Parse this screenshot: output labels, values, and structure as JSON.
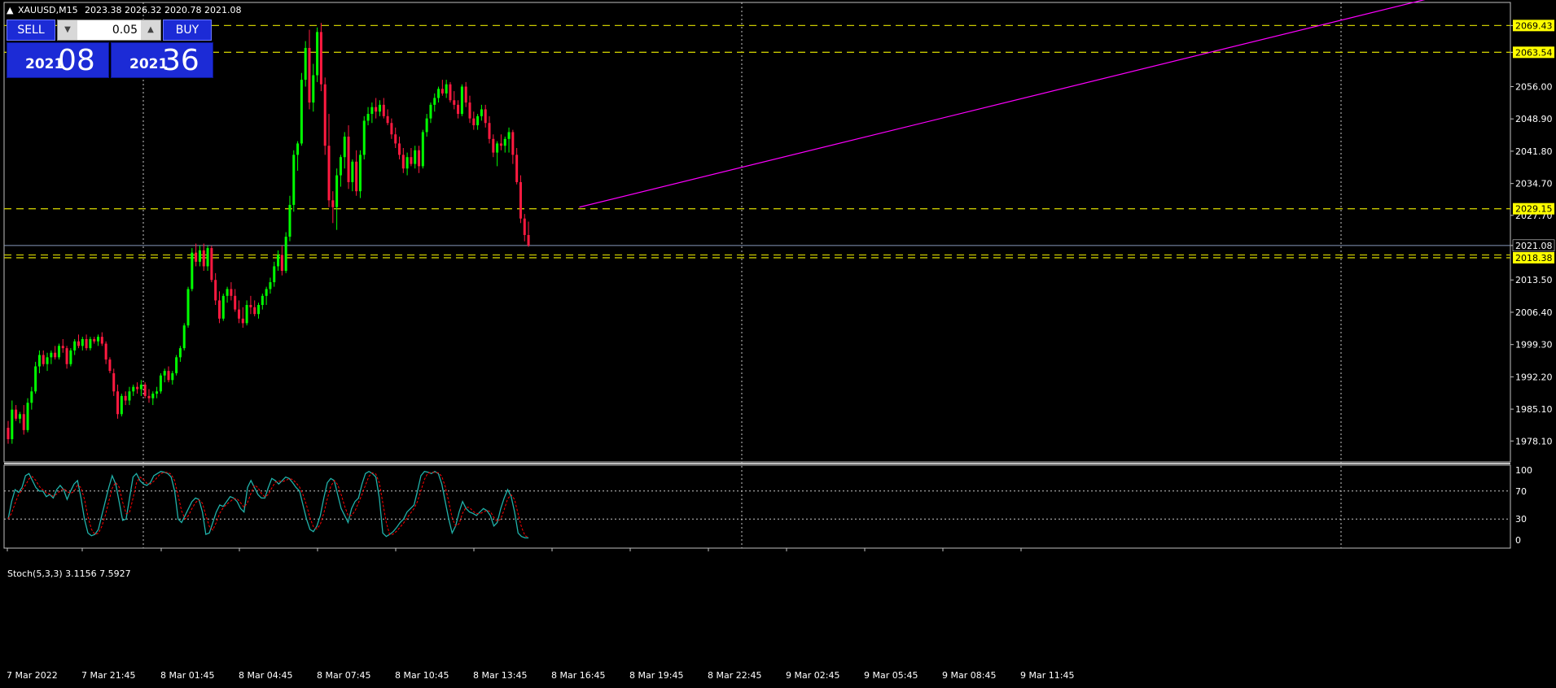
{
  "header": {
    "symbol_label": "XAUUSD,M15",
    "ohlc_label": "2023.38 2026.32 2020.78 2021.08"
  },
  "trade_panel": {
    "sell_label": "SELL",
    "buy_label": "BUY",
    "lot_value": "0.05",
    "down_glyph": "▼",
    "up_glyph": "▲",
    "sell_price_small": "2021",
    "sell_price_big": "08",
    "buy_price_small": "2021",
    "buy_price_big": "36"
  },
  "indicator": {
    "label": "Stoch(5,3,3) 3.1156 7.5927",
    "levels": [
      {
        "text": "100",
        "value": 100
      },
      {
        "text": "70",
        "value": 70
      },
      {
        "text": "30",
        "value": 30
      },
      {
        "text": "0",
        "value": 0
      }
    ],
    "main_color": "#20b2aa",
    "signal_color": "#ff0000",
    "main": [
      30,
      55,
      72,
      68,
      75,
      92,
      95,
      85,
      75,
      70,
      70,
      62,
      65,
      60,
      72,
      78,
      72,
      58,
      70,
      80,
      85,
      60,
      30,
      10,
      6,
      8,
      15,
      35,
      55,
      75,
      92,
      80,
      55,
      28,
      30,
      60,
      90,
      95,
      85,
      80,
      78,
      82,
      92,
      95,
      98,
      97,
      95,
      90,
      70,
      30,
      25,
      35,
      45,
      55,
      60,
      58,
      40,
      8,
      10,
      25,
      40,
      50,
      48,
      55,
      62,
      60,
      55,
      45,
      40,
      75,
      85,
      75,
      65,
      60,
      60,
      75,
      88,
      85,
      80,
      85,
      90,
      88,
      82,
      75,
      70,
      50,
      30,
      15,
      12,
      20,
      35,
      60,
      82,
      88,
      85,
      65,
      45,
      35,
      25,
      45,
      55,
      60,
      80,
      95,
      98,
      95,
      90,
      60,
      10,
      5,
      8,
      12,
      18,
      25,
      30,
      40,
      45,
      50,
      70,
      92,
      98,
      97,
      95,
      98,
      95,
      80,
      55,
      30,
      10,
      20,
      40,
      55,
      45,
      40,
      38,
      35,
      40,
      45,
      42,
      35,
      20,
      25,
      45,
      60,
      72,
      62,
      40,
      10,
      5,
      3,
      3
    ]
  },
  "time_axis": {
    "labels": [
      "7 Mar 2022",
      "7 Mar 21:45",
      "8 Mar 01:45",
      "8 Mar 04:45",
      "8 Mar 07:45",
      "8 Mar 10:45",
      "8 Mar 13:45",
      "8 Mar 16:45",
      "8 Mar 19:45",
      "8 Mar 22:45",
      "9 Mar 02:45",
      "9 Mar 05:45",
      "9 Mar 08:45",
      "9 Mar 11:45"
    ]
  },
  "chart_data": {
    "type": "candlestick",
    "symbol": "XAUUSD",
    "timeframe": "M15",
    "y_range": [
      1973.5,
      2074.5
    ],
    "y_ticks": [
      2069.43,
      2063.54,
      2056.0,
      2048.9,
      2041.8,
      2034.7,
      2027.7,
      2021.08,
      2013.5,
      2006.4,
      1999.3,
      1992.2,
      1985.1,
      1978.1
    ],
    "y_tick_labels": [
      "2069.43",
      "2063.54",
      "2056.00",
      "2048.90",
      "2041.80",
      "2034.70",
      "2027.70",
      "2021.08",
      "2013.50",
      "2006.40",
      "1999.30",
      "1992.20",
      "1985.10",
      "1978.10"
    ],
    "bull_color": "#00ff00",
    "bear_color": "#ff1a40",
    "horizontal_levels": [
      {
        "price": 2069.43,
        "label": "2069.43",
        "color": "#c8c800"
      },
      {
        "price": 2063.54,
        "label": "2063.54",
        "color": "#c8c800"
      },
      {
        "price": 2029.15,
        "label": "2029.15",
        "color": "#c8c800"
      },
      {
        "price": 2019.0,
        "label": "",
        "color": "#c8c800"
      },
      {
        "price": 2018.38,
        "label": "2018.38",
        "color": "#c8c800"
      }
    ],
    "bid_line": {
      "price": 2021.08,
      "label": "2021.08",
      "color": "#8899bb"
    },
    "trendline": {
      "color": "#ff00ff",
      "start_index": 146,
      "start_price": 2029.5,
      "end_index": 344,
      "end_price": 2071.3
    },
    "candles": [
      [
        1981.0,
        1982.5,
        1977.5,
        1978.5
      ],
      [
        1978.5,
        1987.0,
        1977.5,
        1985.0
      ],
      [
        1985.0,
        1986.0,
        1982.5,
        1983.0
      ],
      [
        1983.0,
        1984.5,
        1982.0,
        1984.0
      ],
      [
        1984.0,
        1986.0,
        1979.5,
        1980.5
      ],
      [
        1980.5,
        1987.5,
        1980.0,
        1986.5
      ],
      [
        1986.5,
        1990.0,
        1985.0,
        1989.0
      ],
      [
        1989.0,
        1995.5,
        1988.5,
        1994.5
      ],
      [
        1994.5,
        1998.0,
        1993.0,
        1997.0
      ],
      [
        1997.0,
        1998.0,
        1994.5,
        1995.0
      ],
      [
        1995.0,
        1997.5,
        1993.5,
        1996.5
      ],
      [
        1996.5,
        1998.0,
        1995.0,
        1997.5
      ],
      [
        1997.5,
        1999.0,
        1996.0,
        1996.5
      ],
      [
        1996.5,
        1999.5,
        1996.0,
        1999.0
      ],
      [
        1999.0,
        2000.5,
        1997.5,
        1998.5
      ],
      [
        1998.5,
        1999.0,
        1994.0,
        1995.0
      ],
      [
        1995.0,
        1998.5,
        1994.5,
        1998.0
      ],
      [
        1998.0,
        2000.5,
        1997.0,
        2000.0
      ],
      [
        2000.0,
        2001.5,
        1998.5,
        1999.0
      ],
      [
        1999.0,
        2001.0,
        1998.0,
        2000.5
      ],
      [
        2000.5,
        2001.5,
        1998.0,
        1998.5
      ],
      [
        1998.5,
        2001.0,
        1998.0,
        2000.5
      ],
      [
        2000.5,
        2001.0,
        1999.5,
        2000.0
      ],
      [
        2000.0,
        2001.5,
        1999.0,
        2001.0
      ],
      [
        2001.0,
        2002.0,
        1999.0,
        1999.5
      ],
      [
        1999.5,
        2000.0,
        1995.0,
        1996.0
      ],
      [
        1996.0,
        1996.5,
        1993.0,
        1993.5
      ],
      [
        1993.0,
        1994.0,
        1988.0,
        1989.0
      ],
      [
        1989.0,
        1990.5,
        1983.0,
        1984.0
      ],
      [
        1984.0,
        1988.5,
        1983.5,
        1988.0
      ],
      [
        1988.0,
        1989.0,
        1986.0,
        1987.0
      ],
      [
        1987.0,
        1990.0,
        1986.0,
        1989.0
      ],
      [
        1989.0,
        1990.5,
        1988.0,
        1990.0
      ],
      [
        1990.0,
        1991.0,
        1988.5,
        1989.5
      ],
      [
        1989.5,
        1991.5,
        1988.0,
        1990.5
      ],
      [
        1990.5,
        1991.0,
        1987.5,
        1988.0
      ],
      [
        1988.0,
        1989.5,
        1986.5,
        1987.5
      ],
      [
        1987.5,
        1989.0,
        1986.0,
        1988.5
      ],
      [
        1988.5,
        1990.0,
        1987.5,
        1989.0
      ],
      [
        1989.0,
        1993.0,
        1988.5,
        1992.5
      ],
      [
        1992.5,
        1994.0,
        1991.0,
        1993.5
      ],
      [
        1993.5,
        1994.5,
        1991.0,
        1991.5
      ],
      [
        1991.5,
        1993.5,
        1990.5,
        1993.0
      ],
      [
        1993.0,
        1997.0,
        1992.5,
        1996.5
      ],
      [
        1996.5,
        1999.0,
        1995.5,
        1998.5
      ],
      [
        1998.5,
        2004.0,
        1998.0,
        2003.5
      ],
      [
        2003.5,
        2012.0,
        2003.0,
        2011.5
      ],
      [
        2011.5,
        2020.5,
        2011.0,
        2019.5
      ],
      [
        2019.5,
        2021.5,
        2016.5,
        2017.5
      ],
      [
        2017.5,
        2021.0,
        2016.5,
        2020.0
      ],
      [
        2020.0,
        2021.5,
        2015.5,
        2016.5
      ],
      [
        2016.5,
        2021.0,
        2015.5,
        2020.5
      ],
      [
        2020.5,
        2021.0,
        2013.0,
        2013.5
      ],
      [
        2013.5,
        2015.0,
        2008.0,
        2009.0
      ],
      [
        2009.0,
        2011.0,
        2004.0,
        2005.0
      ],
      [
        2005.0,
        2010.5,
        2004.5,
        2010.0
      ],
      [
        2010.0,
        2012.0,
        2008.5,
        2011.5
      ],
      [
        2011.5,
        2013.0,
        2009.0,
        2010.0
      ],
      [
        2010.0,
        2011.5,
        2006.5,
        2007.0
      ],
      [
        2007.0,
        2009.0,
        2004.0,
        2005.0
      ],
      [
        2005.0,
        2007.5,
        2003.0,
        2004.0
      ],
      [
        2004.0,
        2009.0,
        2003.5,
        2008.0
      ],
      [
        2008.0,
        2010.0,
        2006.0,
        2007.5
      ],
      [
        2007.5,
        2009.0,
        2005.5,
        2006.0
      ],
      [
        2006.0,
        2008.5,
        2005.0,
        2008.0
      ],
      [
        2008.0,
        2010.5,
        2007.0,
        2010.0
      ],
      [
        2010.0,
        2012.0,
        2008.0,
        2011.5
      ],
      [
        2011.5,
        2014.0,
        2010.5,
        2013.0
      ],
      [
        2013.0,
        2017.5,
        2012.0,
        2016.5
      ],
      [
        2016.5,
        2020.0,
        2015.5,
        2019.0
      ],
      [
        2019.0,
        2021.0,
        2014.5,
        2015.5
      ],
      [
        2015.5,
        2024.0,
        2015.0,
        2023.0
      ],
      [
        2023.0,
        2032.0,
        2022.0,
        2030.0
      ],
      [
        2030.0,
        2042.0,
        2028.5,
        2041.0
      ],
      [
        2041.0,
        2044.0,
        2037.5,
        2043.5
      ],
      [
        2043.5,
        2059.0,
        2043.0,
        2057.5
      ],
      [
        2057.5,
        2066.0,
        2056.0,
        2064.5
      ],
      [
        2064.5,
        2068.5,
        2051.0,
        2052.5
      ],
      [
        2052.5,
        2061.0,
        2050.5,
        2058.5
      ],
      [
        2058.5,
        2069.0,
        2057.0,
        2068.0
      ],
      [
        2068.0,
        2070.0,
        2055.0,
        2056.5
      ],
      [
        2056.5,
        2058.0,
        2041.0,
        2043.0
      ],
      [
        2043.0,
        2050.0,
        2029.5,
        2031.0
      ],
      [
        2031.0,
        2033.0,
        2026.0,
        2029.5
      ],
      [
        2029.5,
        2038.0,
        2024.5,
        2036.5
      ],
      [
        2036.5,
        2041.0,
        2034.0,
        2040.5
      ],
      [
        2040.5,
        2046.0,
        2038.0,
        2045.0
      ],
      [
        2045.0,
        2047.5,
        2033.5,
        2035.0
      ],
      [
        2035.0,
        2040.0,
        2033.0,
        2039.5
      ],
      [
        2039.5,
        2042.0,
        2032.0,
        2033.0
      ],
      [
        2033.0,
        2042.0,
        2031.5,
        2041.0
      ],
      [
        2041.0,
        2049.5,
        2040.0,
        2048.5
      ],
      [
        2048.5,
        2051.5,
        2047.5,
        2050.0
      ],
      [
        2050.0,
        2052.5,
        2048.0,
        2051.5
      ],
      [
        2051.5,
        2053.5,
        2049.0,
        2050.5
      ],
      [
        2050.5,
        2053.0,
        2049.5,
        2052.0
      ],
      [
        2052.0,
        2053.5,
        2049.0,
        2049.5
      ],
      [
        2049.5,
        2051.0,
        2047.5,
        2048.0
      ],
      [
        2048.0,
        2049.0,
        2044.5,
        2045.5
      ],
      [
        2045.5,
        2047.0,
        2042.5,
        2043.5
      ],
      [
        2043.5,
        2045.0,
        2040.0,
        2041.0
      ],
      [
        2041.0,
        2042.5,
        2037.0,
        2038.0
      ],
      [
        2038.0,
        2041.5,
        2036.5,
        2040.5
      ],
      [
        2040.5,
        2042.5,
        2038.5,
        2039.0
      ],
      [
        2039.0,
        2043.0,
        2038.0,
        2042.0
      ],
      [
        2042.0,
        2043.0,
        2037.0,
        2038.5
      ],
      [
        2038.5,
        2046.5,
        2038.0,
        2046.0
      ],
      [
        2046.0,
        2050.0,
        2045.0,
        2049.0
      ],
      [
        2049.0,
        2052.5,
        2048.0,
        2052.0
      ],
      [
        2052.0,
        2054.5,
        2050.5,
        2053.5
      ],
      [
        2053.5,
        2056.0,
        2052.5,
        2055.5
      ],
      [
        2055.5,
        2057.5,
        2054.0,
        2054.5
      ],
      [
        2054.5,
        2057.5,
        2053.5,
        2056.5
      ],
      [
        2056.5,
        2057.0,
        2052.5,
        2053.0
      ],
      [
        2053.0,
        2055.0,
        2051.0,
        2052.0
      ],
      [
        2052.0,
        2053.0,
        2049.0,
        2050.0
      ],
      [
        2050.0,
        2056.5,
        2049.5,
        2056.0
      ],
      [
        2056.0,
        2057.0,
        2051.5,
        2052.5
      ],
      [
        2052.5,
        2054.0,
        2048.0,
        2049.0
      ],
      [
        2049.0,
        2050.5,
        2046.5,
        2047.5
      ],
      [
        2047.5,
        2050.0,
        2046.5,
        2049.5
      ],
      [
        2049.5,
        2052.0,
        2048.5,
        2051.0
      ],
      [
        2051.0,
        2052.0,
        2047.0,
        2048.0
      ],
      [
        2048.0,
        2049.5,
        2043.5,
        2044.5
      ],
      [
        2044.5,
        2045.5,
        2040.5,
        2041.5
      ],
      [
        2041.5,
        2044.0,
        2038.5,
        2043.5
      ],
      [
        2043.5,
        2045.5,
        2042.0,
        2043.0
      ],
      [
        2043.0,
        2045.0,
        2041.5,
        2044.5
      ],
      [
        2044.5,
        2047.0,
        2041.5,
        2046.0
      ],
      [
        2046.0,
        2046.5,
        2039.0,
        2041.0
      ],
      [
        2041.0,
        2042.5,
        2034.5,
        2035.0
      ],
      [
        2035.0,
        2036.5,
        2026.0,
        2027.0
      ],
      [
        2027.0,
        2028.0,
        2022.0,
        2023.38
      ],
      [
        2023.38,
        2026.32,
        2020.78,
        2021.08
      ]
    ]
  }
}
